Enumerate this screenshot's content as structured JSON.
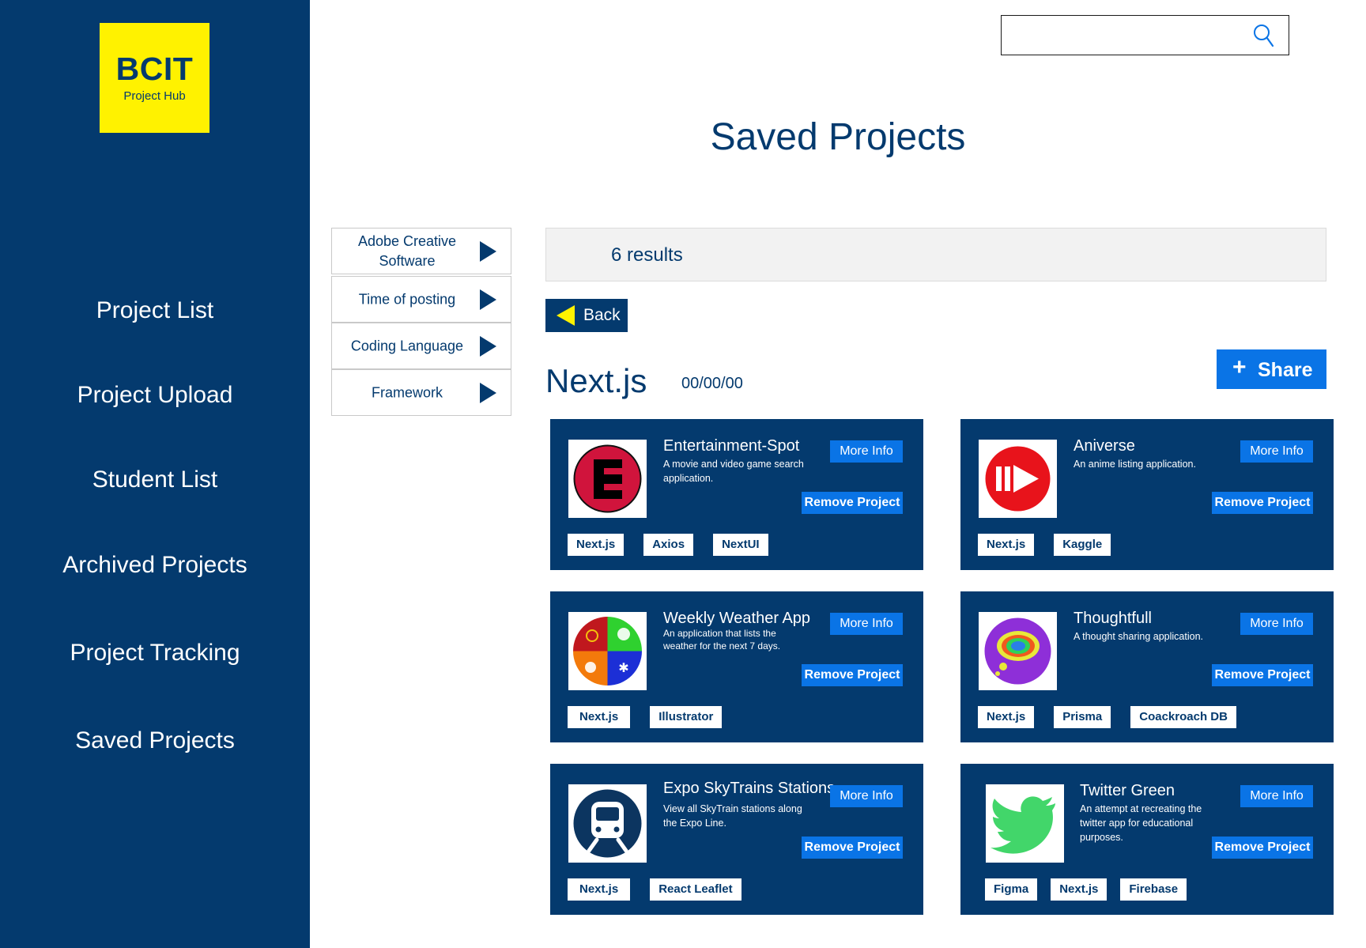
{
  "app": {
    "logo_title": "BCIT",
    "logo_subtitle": "Project Hub"
  },
  "nav": [
    "Project List",
    "Project Upload",
    "Student List",
    "Archived Projects",
    "Project Tracking",
    "Saved Projects"
  ],
  "search": {
    "value": "",
    "placeholder": ""
  },
  "page": {
    "title": "Saved Projects",
    "results": "6 results",
    "back_label": "Back",
    "share_label": "Share",
    "section_title": "Next.js",
    "section_date": "00/00/00"
  },
  "filters": [
    "Adobe Creative Software",
    "Time of posting",
    "Coding Language",
    "Framework"
  ],
  "cards": [
    {
      "title": "Entertainment-Spot",
      "desc": "A movie and video game search application.",
      "more": "More Info",
      "remove": "Remove Project",
      "tags": [
        "Next.js",
        "Axios",
        "NextUI"
      ],
      "icon": "entertainment-logo-icon"
    },
    {
      "title": "Aniverse",
      "desc": "An anime listing application.",
      "more": "More Info",
      "remove": "Remove Project",
      "tags": [
        "Next.js",
        "Kaggle"
      ],
      "icon": "play-logo-icon"
    },
    {
      "title": "Weekly Weather App",
      "desc": "An application that lists the weather for the next 7 days.",
      "more": "More Info",
      "remove": "Remove Project",
      "tags": [
        "Next.js",
        "Illustrator"
      ],
      "icon": "weather-logo-icon"
    },
    {
      "title": "Thoughtfull",
      "desc": "A thought sharing application.",
      "more": "More Info",
      "remove": "Remove Project",
      "tags": [
        "Next.js",
        "Prisma",
        "Coackroach DB"
      ],
      "icon": "thought-bubble-icon"
    },
    {
      "title": "Expo SkyTrains Stations",
      "desc": "View all SkyTrain stations along the Expo Line.",
      "more": "More Info",
      "remove": "Remove Project",
      "tags": [
        "Next.js",
        "React Leaflet"
      ],
      "icon": "train-icon"
    },
    {
      "title": "Twitter Green",
      "desc": "An attempt at recreating the twitter app for educational purposes.",
      "more": "More Info",
      "remove": "Remove Project",
      "tags": [
        "Figma",
        "Next.js",
        "Firebase"
      ],
      "icon": "bird-icon"
    }
  ],
  "colors": {
    "navy": "#043a6e",
    "accent_blue": "#0a74e6",
    "logo_yellow": "#fff200",
    "results_bg": "#f2f2f2"
  }
}
